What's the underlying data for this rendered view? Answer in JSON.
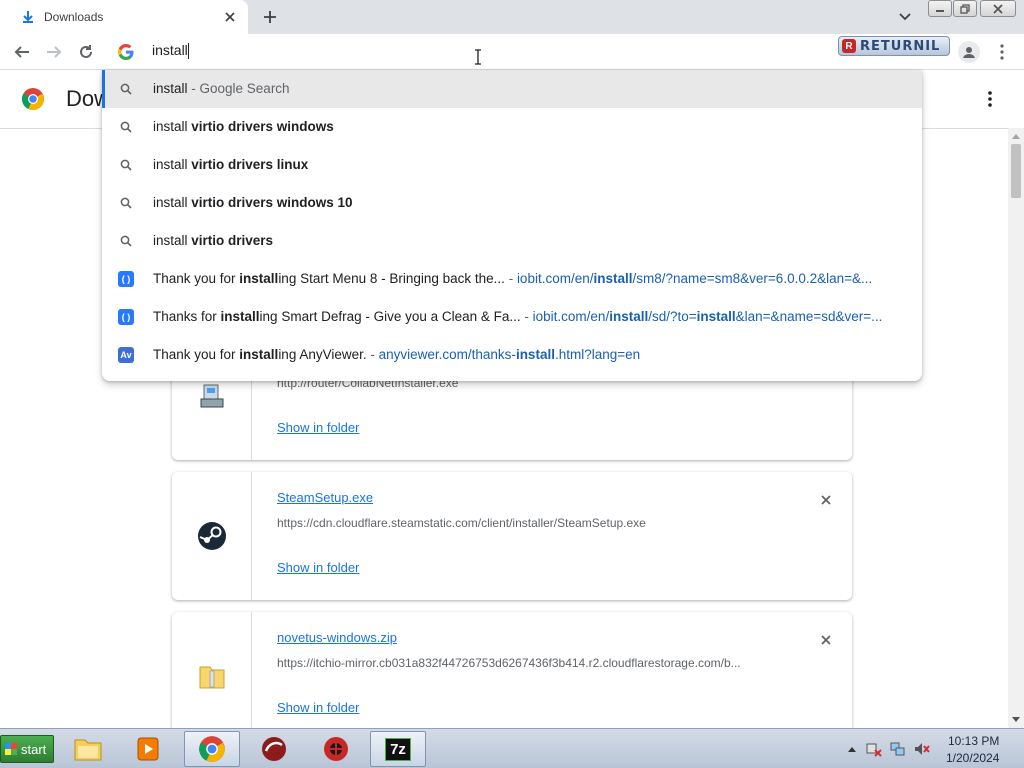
{
  "tab": {
    "title": "Downloads"
  },
  "omnibox": {
    "value": "install"
  },
  "returnil": {
    "label": "RETURNIL",
    "logo": "R"
  },
  "page": {
    "title": "Dow"
  },
  "suggestions": [
    {
      "icon": "search-icon",
      "typed": "install",
      "rest": "",
      "dim": " - Google Search",
      "url_pre": "",
      "url_bold": "",
      "url_post": ""
    },
    {
      "icon": "search-icon",
      "typed": "install",
      "rest": " virtio drivers windows",
      "dim": "",
      "url_pre": "",
      "url_bold": "",
      "url_post": ""
    },
    {
      "icon": "search-icon",
      "typed": "install",
      "rest": " virtio drivers linux",
      "dim": "",
      "url_pre": "",
      "url_bold": "",
      "url_post": ""
    },
    {
      "icon": "search-icon",
      "typed": "install",
      "rest": " virtio drivers windows 10",
      "dim": "",
      "url_pre": "",
      "url_bold": "",
      "url_post": ""
    },
    {
      "icon": "search-icon",
      "typed": "install",
      "rest": " virtio drivers",
      "dim": "",
      "url_pre": "",
      "url_bold": "",
      "url_post": ""
    },
    {
      "icon": "iobit-icon",
      "pre": "Thank you for ",
      "bold": "install",
      "post": "ing Start Menu 8 - Bringing back the...",
      "sep": " - ",
      "url_pre": "iobit.com/en/",
      "url_bold": "install",
      "url_post": "/sm8/?name=sm8&ver=6.0.0.2&lan=&..."
    },
    {
      "icon": "iobit-icon",
      "pre": "Thanks for ",
      "bold": "install",
      "post": "ing Smart Defrag - Give you a Clean & Fa...",
      "sep": " - ",
      "url_pre": "iobit.com/en/",
      "url_bold": "install",
      "url_post": "/sd/?to=",
      "url_bold2": "install",
      "url_post2": "&lan=&name=sd&ver=..."
    },
    {
      "icon": "anyviewer-icon",
      "pre": "Thank you for ",
      "bold": "install",
      "post": "ing AnyViewer.",
      "sep": " - ",
      "url_pre": "anyviewer.com/thanks-",
      "url_bold": "install",
      "url_post": ".html?lang=en"
    }
  ],
  "downloads": [
    {
      "name": "",
      "url": "http://router/CollabNetInstaller.exe",
      "action": "Show in folder",
      "icon": "installer-icon"
    },
    {
      "name": "SteamSetup.exe",
      "url": "https://cdn.cloudflare.steamstatic.com/client/installer/SteamSetup.exe",
      "action": "Show in folder",
      "icon": "steam-icon"
    },
    {
      "name": "novetus-windows.zip",
      "url": "https://itchio-mirror.cb031a832f44726753d6267436f3b414.r2.cloudflarestorage.com/b...",
      "action": "Show in folder",
      "icon": "zip-folder-icon"
    }
  ],
  "taskbar": {
    "start_label": "start",
    "apps": [
      "file-explorer-icon",
      "media-player-icon",
      "chrome-icon",
      "returnil-app-icon",
      "security-app-icon",
      "7zip-icon"
    ],
    "sevenzip_label": "7z",
    "clock_time": "10:13 PM",
    "clock_date": "1/20/2024"
  },
  "colors": {
    "accent": "#1a73e8",
    "url": "#1a5fb4",
    "tabstrip": "#dee1e6"
  }
}
